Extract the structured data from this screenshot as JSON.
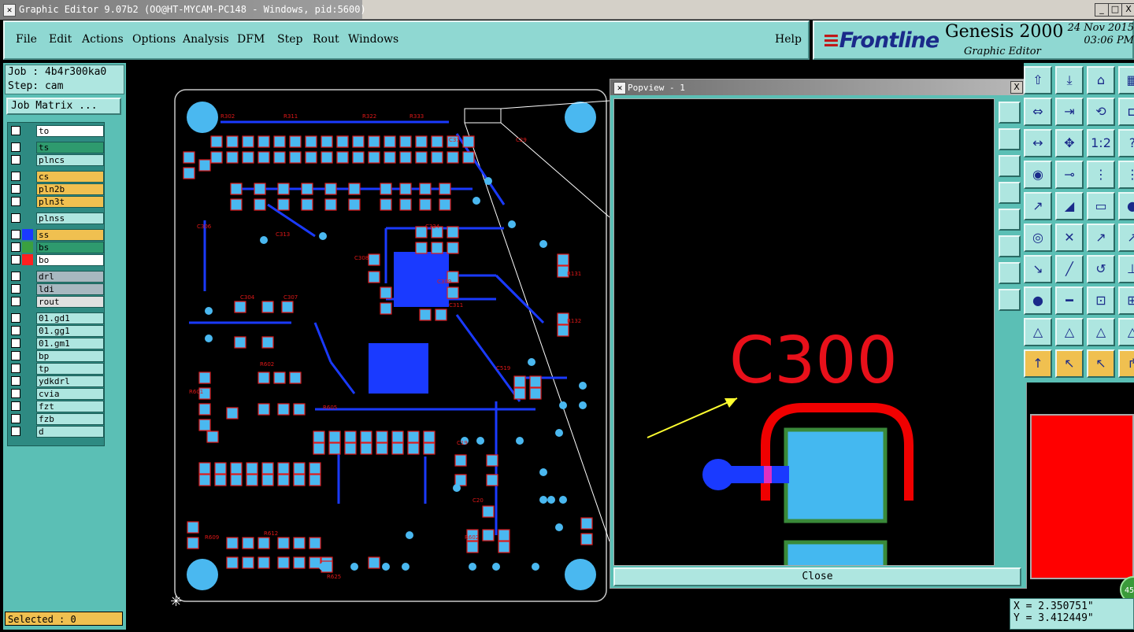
{
  "window": {
    "title": "Graphic Editor 9.07b2 (OO@HT-MYCAM-PC148 - Windows, pid:5600)",
    "minimize": "_",
    "maximize": "□",
    "close": "X"
  },
  "menu": {
    "items": [
      "File",
      "Edit",
      "Actions",
      "Options",
      "Analysis",
      "DFM",
      "Step",
      "Rout",
      "Windows"
    ],
    "help": "Help"
  },
  "brand": {
    "logo": "Frontline",
    "product": "Genesis 2000",
    "subtitle": "Graphic Editor",
    "date": "24 Nov 2015",
    "time": "03:06 PM"
  },
  "job": {
    "job_label": "Job : 4b4r300ka0",
    "step_label": "Step: cam",
    "matrix_button": "Job Matrix ..."
  },
  "layers": [
    {
      "name": "to",
      "color": "#ffffff",
      "swatch": ""
    },
    {
      "name": "ts",
      "color": "#2e9a6e",
      "swatch": ""
    },
    {
      "name": "plncs",
      "color": "#aee6e0",
      "swatch": ""
    },
    {
      "name": "cs",
      "color": "#f0c050",
      "swatch": ""
    },
    {
      "name": "pln2b",
      "color": "#f0c050",
      "swatch": ""
    },
    {
      "name": "pln3t",
      "color": "#f0c050",
      "swatch": ""
    },
    {
      "name": "plnss",
      "color": "#aee6e0",
      "swatch": ""
    },
    {
      "name": "ss",
      "color": "#f0c050",
      "swatch": "#1a3aff"
    },
    {
      "name": "bs",
      "color": "#2e9a6e",
      "swatch": "#3aa040"
    },
    {
      "name": "bo",
      "color": "#ffffff",
      "swatch": "#ff2020"
    },
    {
      "name": "drl",
      "color": "#a8b8c0",
      "swatch": ""
    },
    {
      "name": "ldi",
      "color": "#a8b8c0",
      "swatch": ""
    },
    {
      "name": "rout",
      "color": "#e0e0e0",
      "swatch": ""
    },
    {
      "name": "01.gd1",
      "color": "#aee6e0",
      "swatch": ""
    },
    {
      "name": "01.gg1",
      "color": "#aee6e0",
      "swatch": ""
    },
    {
      "name": "01.gm1",
      "color": "#aee6e0",
      "swatch": ""
    },
    {
      "name": "bp",
      "color": "#aee6e0",
      "swatch": ""
    },
    {
      "name": "tp",
      "color": "#aee6e0",
      "swatch": ""
    },
    {
      "name": "ydkdrl",
      "color": "#aee6e0",
      "swatch": ""
    },
    {
      "name": "cvia",
      "color": "#aee6e0",
      "swatch": ""
    },
    {
      "name": "fzt",
      "color": "#aee6e0",
      "swatch": ""
    },
    {
      "name": "fzb",
      "color": "#aee6e0",
      "swatch": ""
    },
    {
      "name": "d",
      "color": "#aee6e0",
      "swatch": ""
    }
  ],
  "status": {
    "selected": "Selected : 0"
  },
  "popview": {
    "title": "Popview - 1",
    "close_button": "Close",
    "label": "C300",
    "close_icon": "X"
  },
  "coords": {
    "x": "X = 2.350751\"",
    "y": "Y = 3.412449\""
  },
  "misc": {
    "zoom_badge": "45"
  }
}
